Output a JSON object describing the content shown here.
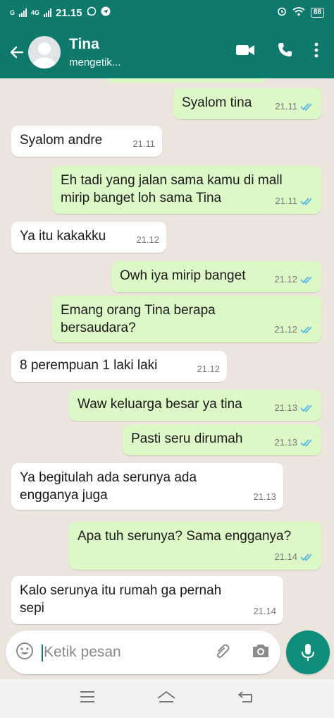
{
  "status_bar": {
    "network": "G",
    "network2": "4G",
    "time": "21.15",
    "battery": "88"
  },
  "header": {
    "contact_name": "Tina",
    "contact_status": "mengetik..."
  },
  "messages": [
    {
      "dir": "out",
      "text": "Syalom tina",
      "time": "21.11",
      "read": true
    },
    {
      "dir": "in",
      "text": "Syalom andre",
      "time": "21.11"
    },
    {
      "dir": "out",
      "text": "Eh tadi yang jalan sama kamu di mall mirip banget loh sama Tina",
      "time": "21.11",
      "read": true
    },
    {
      "dir": "in",
      "text": "Ya itu kakakku",
      "time": "21.12"
    },
    {
      "dir": "out",
      "text": "Owh iya mirip banget",
      "time": "21.12",
      "read": true
    },
    {
      "dir": "out",
      "text": "Emang orang Tina berapa bersaudara?",
      "time": "21.12",
      "read": true
    },
    {
      "dir": "in",
      "text": "8 perempuan 1 laki laki",
      "time": "21.12"
    },
    {
      "dir": "out",
      "text": "Waw keluarga besar ya tina",
      "time": "21.13",
      "read": true
    },
    {
      "dir": "out",
      "text": "Pasti seru dirumah",
      "time": "21.13",
      "read": true
    },
    {
      "dir": "in",
      "text": "Ya begitulah ada serunya ada engganya juga",
      "time": "21.13"
    },
    {
      "dir": "out",
      "text": "Apa tuh serunya? Sama engganya?",
      "time": "21.14",
      "read": true
    },
    {
      "dir": "in",
      "text": "Kalo serunya itu rumah ga pernah sepi",
      "time": "21.14"
    }
  ],
  "input": {
    "placeholder": "Ketik pesan"
  },
  "colors": {
    "header": "#0f7a6b",
    "outgoing": "#dcf8c6",
    "incoming": "#ffffff",
    "read_ticks": "#4fb6ec",
    "chat_bg": "#ece5dd"
  }
}
